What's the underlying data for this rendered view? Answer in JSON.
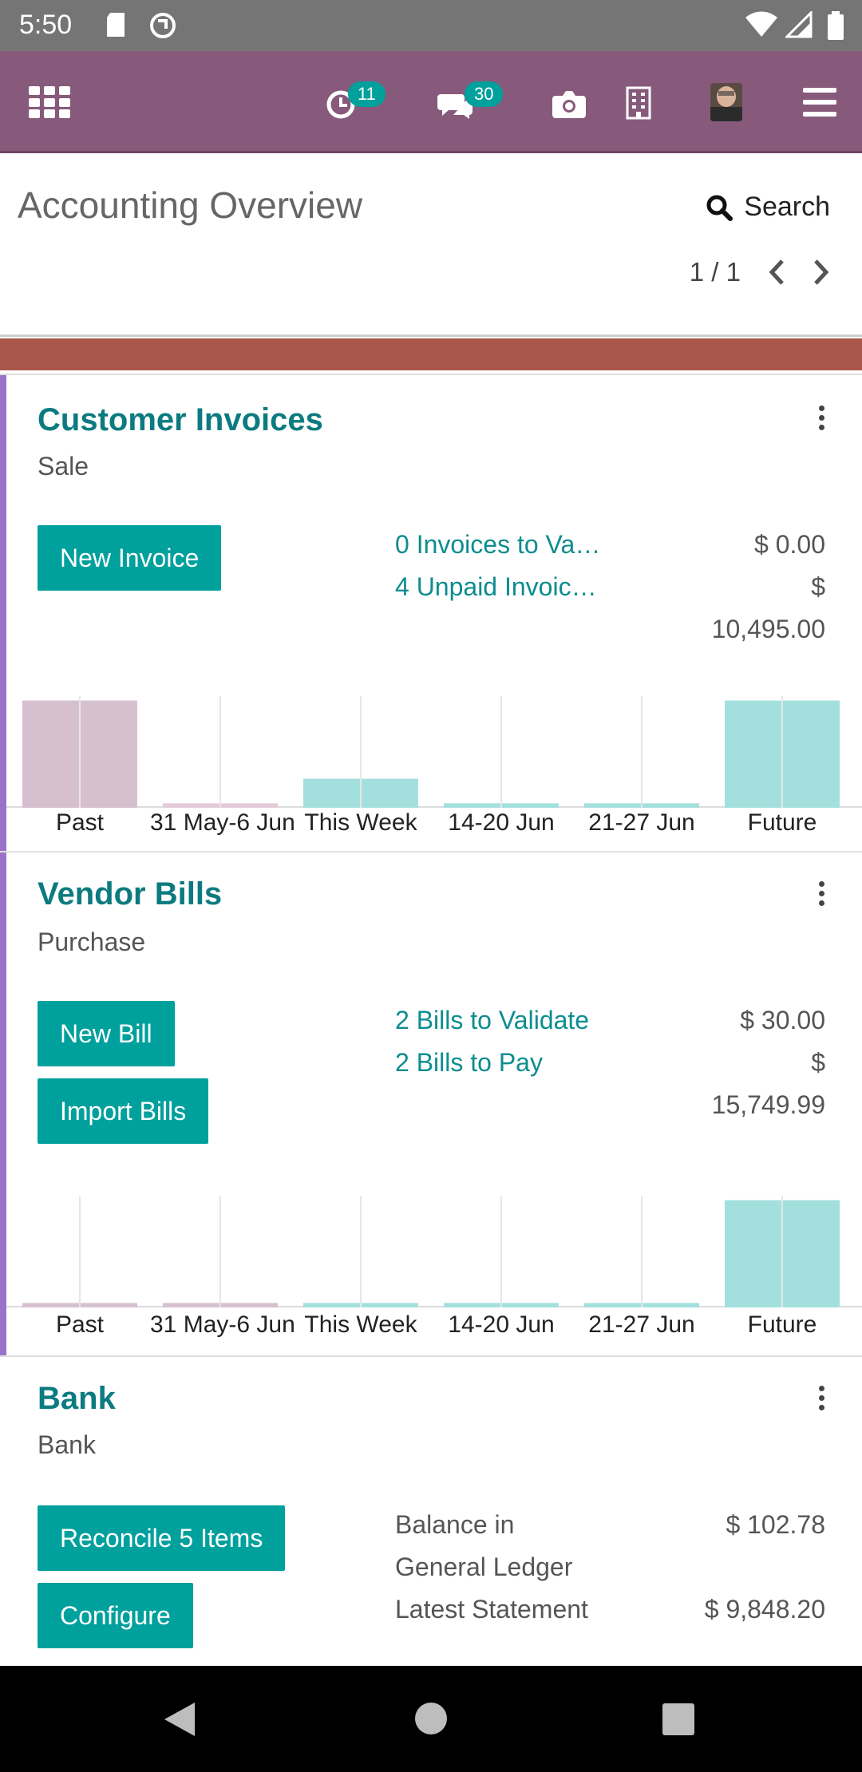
{
  "status_bar": {
    "time": "5:50"
  },
  "nav": {
    "activity_count": "11",
    "messages_count": "30"
  },
  "control": {
    "title": "Accounting Overview",
    "search_label": "Search",
    "pager": "1 / 1"
  },
  "colors": {
    "nav_bg": "#875a7b",
    "teal": "#00a09d",
    "title_teal": "#0c7b80",
    "bar_past": "#d6c0d0",
    "bar_future": "#a3e0dd",
    "accent_band": "#a9574a"
  },
  "cards": [
    {
      "title": "Customer Invoices",
      "subtitle": "Sale",
      "buttons": [
        "New Invoice"
      ],
      "stats": [
        {
          "label": "0 Invoices to Va…",
          "value": "$ 0.00"
        },
        {
          "label": "4 Unpaid Invoic…",
          "value": "$",
          "value2": "10,495.00"
        }
      ]
    },
    {
      "title": "Vendor Bills",
      "subtitle": "Purchase",
      "buttons": [
        "New Bill",
        "Import Bills"
      ],
      "stats": [
        {
          "label": "2 Bills to Validate",
          "value": "$ 30.00"
        },
        {
          "label": "2 Bills to Pay",
          "value": "$",
          "value2": "15,749.99"
        }
      ]
    },
    {
      "title": "Bank",
      "subtitle": "Bank",
      "buttons": [
        "Reconcile 5 Items",
        "Configure"
      ],
      "stats": [
        {
          "label": "Balance in",
          "label2": "General Ledger",
          "value": "$ 102.78"
        },
        {
          "label": "Latest Statement",
          "value": "$ 9,848.20"
        }
      ]
    }
  ],
  "chart_data": [
    {
      "type": "bar",
      "categories": [
        "Past",
        "31 May-6 Jun",
        "This Week",
        "14-20 Jun",
        "21-27 Jun",
        "Future"
      ],
      "values": [
        0.48,
        0.02,
        0.13,
        0.02,
        0.02,
        0.48
      ],
      "colors": [
        "#d6c0d0",
        "#e4cbd8",
        "#a3e0dd",
        "#a3e0dd",
        "#a3e0dd",
        "#a3e0dd"
      ]
    },
    {
      "type": "bar",
      "categories": [
        "Past",
        "31 May-6 Jun",
        "This Week",
        "14-20 Jun",
        "21-27 Jun",
        "Future"
      ],
      "values": [
        0.02,
        0.02,
        0.02,
        0.02,
        0.02,
        0.48
      ],
      "colors": [
        "#d6c0d0",
        "#d6c0d0",
        "#a3e0dd",
        "#a3e0dd",
        "#a3e0dd",
        "#a3e0dd"
      ]
    }
  ]
}
